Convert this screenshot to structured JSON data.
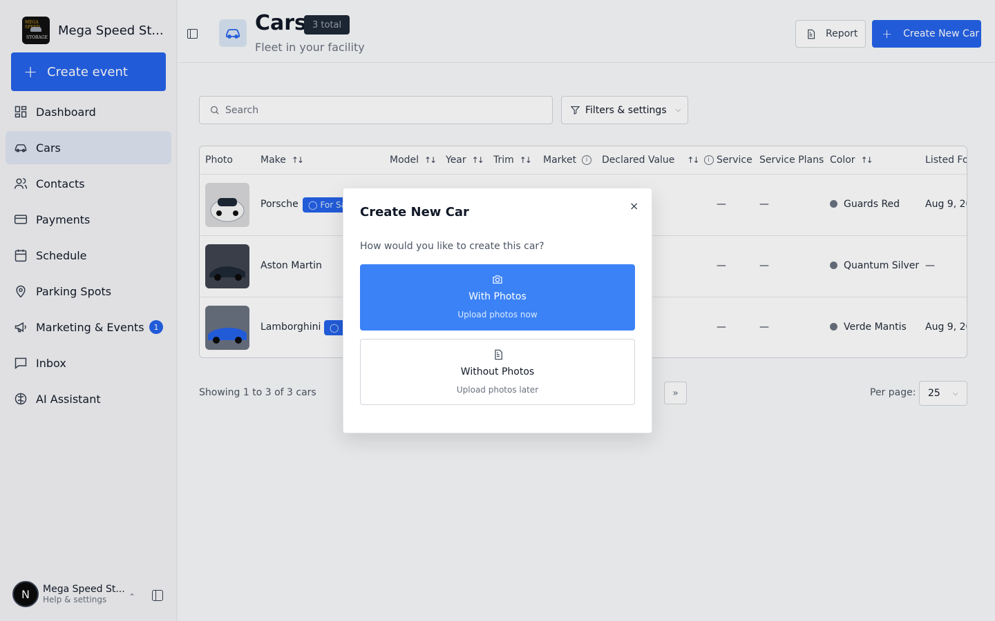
{
  "brand": {
    "name": "Mega Speed St...",
    "logo_text_top": "MEGA SPEED",
    "logo_text_bottom": "STORAGE"
  },
  "sidebar": {
    "create_event": "Create event",
    "items": [
      {
        "label": "Dashboard",
        "icon": "dashboard-icon"
      },
      {
        "label": "Cars",
        "icon": "car-icon",
        "active": true
      },
      {
        "label": "Contacts",
        "icon": "contacts-icon"
      },
      {
        "label": "Payments",
        "icon": "credit-card-icon"
      },
      {
        "label": "Schedule",
        "icon": "calendar-icon"
      },
      {
        "label": "Parking Spots",
        "icon": "map-pin-icon"
      },
      {
        "label": "Marketing & Events",
        "icon": "megaphone-icon",
        "badge": "1"
      },
      {
        "label": "Inbox",
        "icon": "message-square-icon"
      },
      {
        "label": "AI Assistant",
        "icon": "brain-icon"
      }
    ],
    "user": {
      "initial": "N",
      "name": "Mega Speed St...",
      "subtitle": "Help & settings"
    }
  },
  "header": {
    "title": "Cars",
    "badge": "3 total",
    "subtitle": "Fleet in your facility",
    "report_label": "Report",
    "create_label": "Create New Car"
  },
  "toolbar": {
    "search_placeholder": "Search",
    "filters_label": "Filters & settings"
  },
  "table": {
    "columns": [
      "Photo",
      "Make",
      "Model",
      "Year",
      "Trim",
      "Market",
      "Declared Value",
      "Service",
      "Service Plans",
      "Color",
      "Listed Fo"
    ],
    "rows": [
      {
        "make": "Porsche",
        "tag": "For Sa",
        "service": "—",
        "service_plans": "—",
        "color": "Guards Red",
        "listed": "Aug 9, 20"
      },
      {
        "make": "Aston Martin",
        "tag": "",
        "service": "—",
        "service_plans": "—",
        "color": "Quantum Silver",
        "listed": "—"
      },
      {
        "make": "Lamborghini",
        "tag": "",
        "service": "—",
        "service_plans": "—",
        "color": "Verde Mantis",
        "listed": "Aug 9, 20"
      }
    ]
  },
  "pagination": {
    "showing": "Showing 1 to 3 of 3 cars",
    "last_page": "»",
    "per_page_label": "Per page:",
    "per_page_value": "25"
  },
  "modal": {
    "title": "Create New Car",
    "close": "×",
    "question": "How would you like to create this car?",
    "with_photos": {
      "title": "With Photos",
      "subtitle": "Upload photos now"
    },
    "without_photos": {
      "title": "Without Photos",
      "subtitle": "Upload photos later"
    }
  },
  "colors": {
    "accent": "#2563eb",
    "accent_light": "#3b82f6",
    "nav_active": "#e0e7f3"
  }
}
